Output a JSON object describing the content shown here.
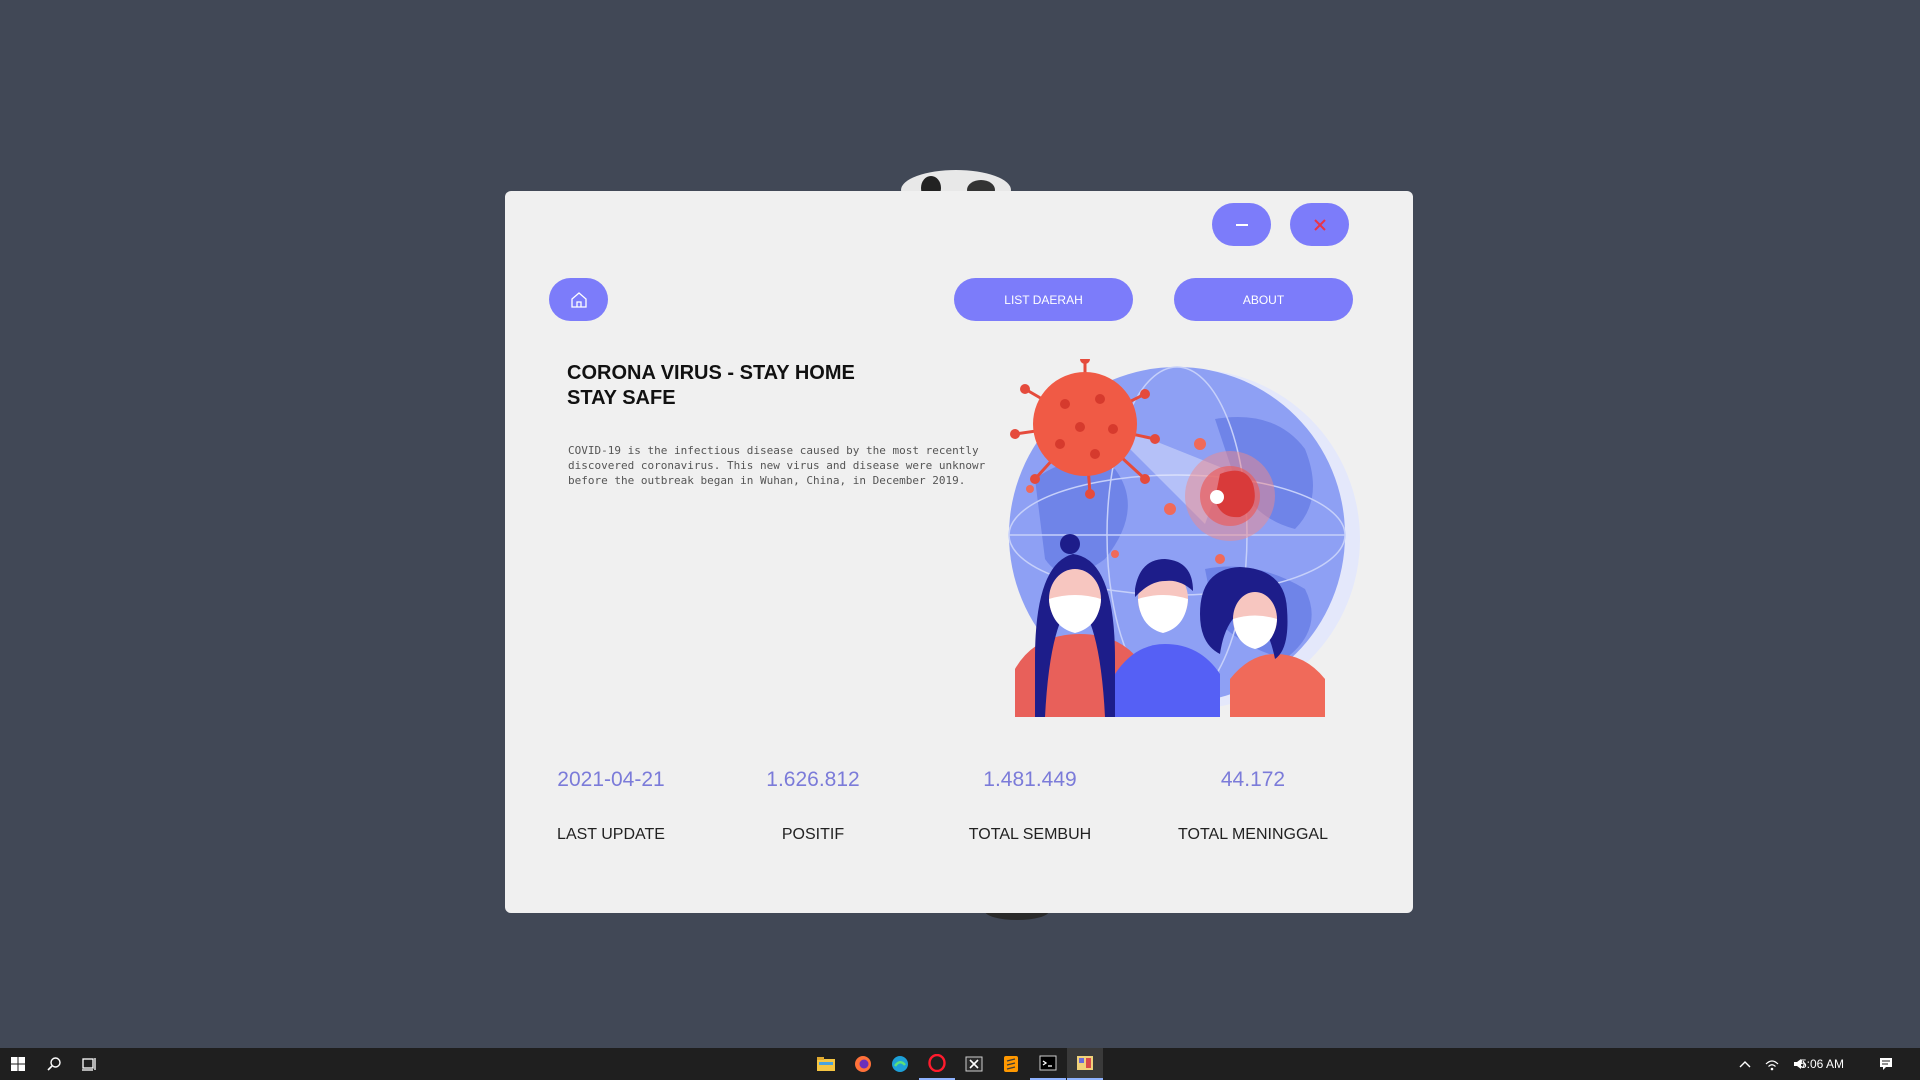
{
  "window": {
    "nav": {
      "list_label": "LIST DAERAH",
      "about_label": "ABOUT"
    },
    "heading": {
      "line1": "CORONA VIRUS - STAY HOME",
      "line2": "STAY SAFE"
    },
    "description": {
      "line1": "COVID-19 is the infectious disease caused by the most recently",
      "line2": "discovered coronavirus. This new virus and disease were unknowr",
      "line3": "before the outbreak began in Wuhan, China, in December 2019."
    },
    "stats": [
      {
        "value": "2021-04-21",
        "label": "LAST UPDATE"
      },
      {
        "value": "1.626.812",
        "label": "POSITIF"
      },
      {
        "value": "1.481.449",
        "label": "TOTAL SEMBUH"
      },
      {
        "value": "44.172",
        "label": "TOTAL MENINGGAL"
      }
    ]
  },
  "taskbar": {
    "apps": [
      "start-icon",
      "search-icon",
      "task-view-icon",
      "file-explorer-icon",
      "firefox-icon",
      "edge-icon",
      "opera-icon",
      "excel-icon",
      "sublime-icon",
      "terminal-icon",
      "app-icon"
    ],
    "clock": "5:06 AM"
  },
  "colors": {
    "accent": "#7c7cfa",
    "background": "#414856",
    "window": "#f0f0f0",
    "stat_value": "#7b7bd9"
  }
}
